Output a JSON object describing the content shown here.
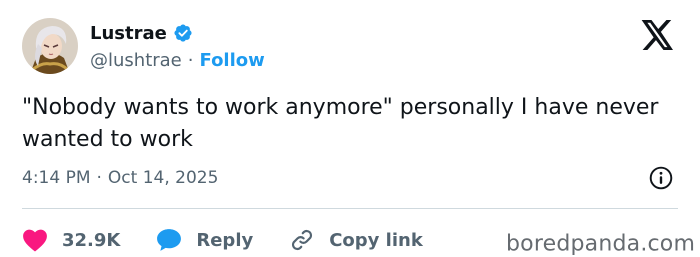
{
  "author": {
    "display_name": "Lustrae",
    "handle": "@lushtrae",
    "separator": "·",
    "follow_label": "Follow",
    "verified": true
  },
  "tweet": {
    "text": "\"Nobody wants to work anymore\" personally I have never wanted to work",
    "time": "4:14 PM",
    "separator": "·",
    "date": "Oct 14, 2025"
  },
  "actions": {
    "likes_count": "32.9K",
    "reply_label": "Reply",
    "copy_link_label": "Copy link"
  },
  "watermark": "boredpanda.com",
  "colors": {
    "accent": "#1d9bf0",
    "like": "#f91880",
    "text": "#0f1419",
    "secondary": "#536471"
  }
}
